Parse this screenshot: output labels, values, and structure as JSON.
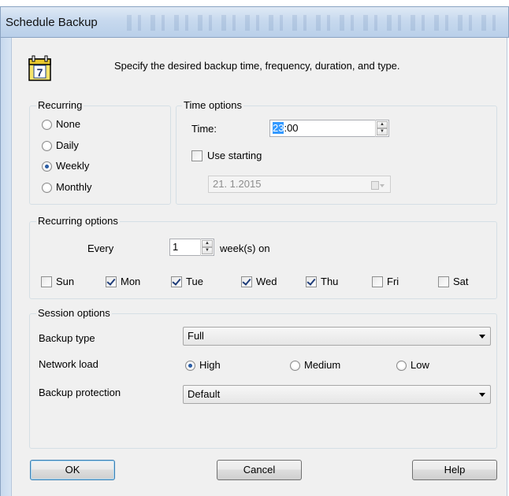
{
  "window": {
    "title": "Schedule Backup"
  },
  "intro": {
    "icon": "calendar-icon",
    "calendar_day": "7",
    "text": "Specify the desired backup time, frequency, duration, and type."
  },
  "recurring": {
    "group_label": "Recurring",
    "options": [
      {
        "label": "None",
        "checked": false
      },
      {
        "label": "Daily",
        "checked": false
      },
      {
        "label": "Weekly",
        "checked": true
      },
      {
        "label": "Monthly",
        "checked": false
      }
    ]
  },
  "time_options": {
    "group_label": "Time options",
    "time_label": "Time:",
    "time_hour": "23",
    "time_rest": ":00",
    "use_starting_label": "Use starting",
    "use_starting_checked": false,
    "start_date": "21.  1.2015"
  },
  "recurring_options": {
    "group_label": "Recurring options",
    "every_label": "Every",
    "every_value": "1",
    "unit_label": "week(s) on",
    "days": [
      {
        "label": "Sun",
        "checked": false
      },
      {
        "label": "Mon",
        "checked": true
      },
      {
        "label": "Tue",
        "checked": true
      },
      {
        "label": "Wed",
        "checked": true
      },
      {
        "label": "Thu",
        "checked": true
      },
      {
        "label": "Fri",
        "checked": false
      },
      {
        "label": "Sat",
        "checked": false
      }
    ]
  },
  "session_options": {
    "group_label": "Session options",
    "backup_type_label": "Backup type",
    "backup_type_value": "Full",
    "network_load_label": "Network load",
    "network_load_options": [
      {
        "label": "High",
        "checked": true
      },
      {
        "label": "Medium",
        "checked": false
      },
      {
        "label": "Low",
        "checked": false
      }
    ],
    "backup_protection_label": "Backup protection",
    "backup_protection_value": "Default"
  },
  "buttons": {
    "ok": "OK",
    "cancel": "Cancel",
    "help": "Help"
  },
  "colors": {
    "accent": "#3399ff",
    "title_bar": "#c7d9ee",
    "dialog_bg": "#f0f0f0"
  }
}
